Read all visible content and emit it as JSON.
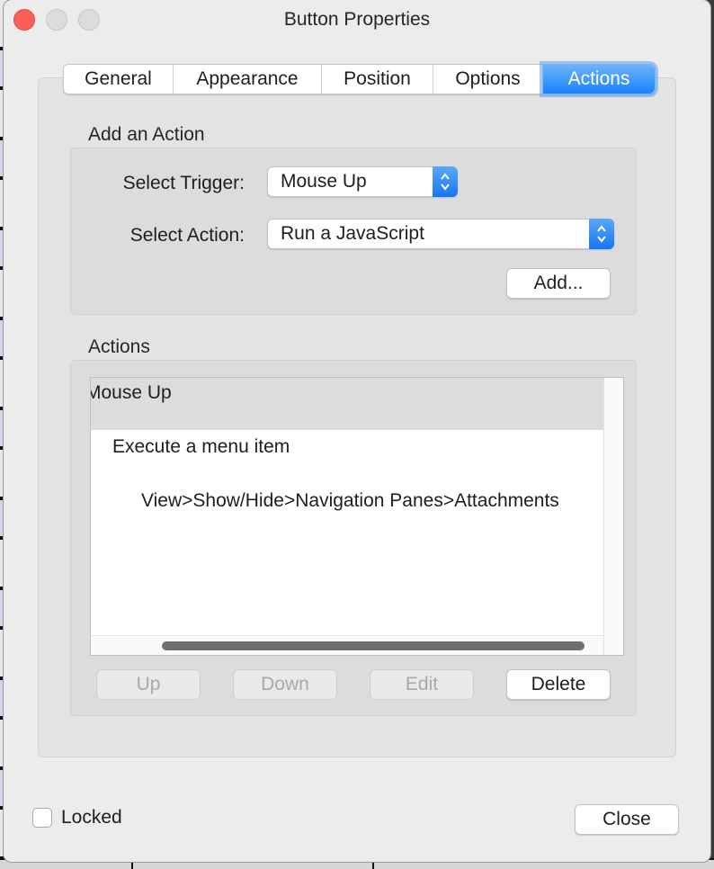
{
  "window": {
    "title": "Button Properties"
  },
  "tabs": [
    {
      "label": "General",
      "active": false
    },
    {
      "label": "Appearance",
      "active": false
    },
    {
      "label": "Position",
      "active": false
    },
    {
      "label": "Options",
      "active": false
    },
    {
      "label": "Actions",
      "active": true
    }
  ],
  "add_action": {
    "section_label": "Add an Action",
    "trigger_label": "Select Trigger:",
    "trigger_value": "Mouse Up",
    "action_label": "Select Action:",
    "action_value": "Run a JavaScript",
    "add_button": "Add..."
  },
  "actions": {
    "section_label": "Actions",
    "list": {
      "trigger": "Mouse Up",
      "action": "Execute a menu item",
      "detail": "View>Show/Hide>Navigation Panes>Attachments"
    },
    "buttons": {
      "up": "Up",
      "down": "Down",
      "edit": "Edit",
      "delete": "Delete"
    }
  },
  "footer": {
    "locked_label": "Locked",
    "locked_checked": false,
    "close_button": "Close"
  },
  "colors": {
    "accent": "#1a82fb",
    "close_traffic_light": "#fc5f57"
  }
}
